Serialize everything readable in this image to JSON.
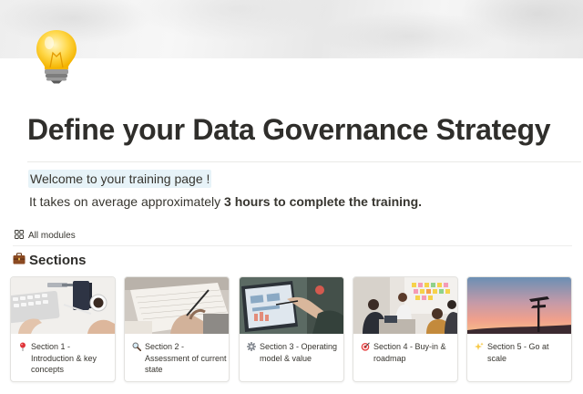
{
  "page": {
    "title": "Define your Data Governance Strategy",
    "icon": "lightbulb-icon"
  },
  "intro": {
    "welcome": "Welcome to your training page !",
    "duration_prefix": "It takes on average approximately ",
    "duration_bold": "3 hours to complete the training."
  },
  "view_tab": {
    "label": "All modules",
    "icon": "gallery-grid-icon"
  },
  "sections": {
    "heading": "Sections",
    "heading_icon": "briefcase-icon",
    "cards": [
      {
        "icon": "round-pushpin-icon",
        "label": "Section 1 - Introduction & key concepts"
      },
      {
        "icon": "magnifying-glass-icon",
        "label": "Section 2 - Assessment of current state"
      },
      {
        "icon": "gear-icon",
        "label": "Section 3 - Operating model & value"
      },
      {
        "icon": "direct-hit-target-icon",
        "label": "Section 4 - Buy-in & roadmap"
      },
      {
        "icon": "sparkles-icon",
        "label": "Section 5 - Go at scale"
      }
    ]
  },
  "colors": {
    "text": "#37352f",
    "welcome_highlight": "#e7f3f8",
    "card_border": "#e3e2df"
  }
}
